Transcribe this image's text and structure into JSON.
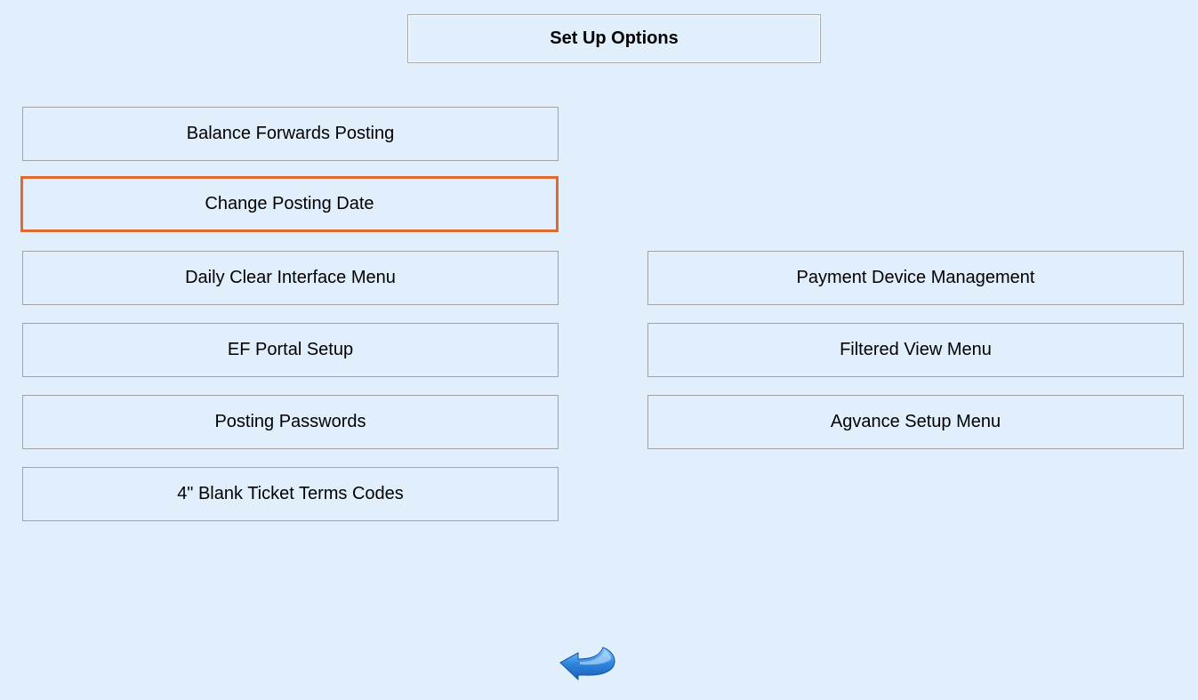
{
  "header": {
    "title": "Set Up Options"
  },
  "menu": {
    "left": [
      {
        "label": "Balance Forwards Posting"
      },
      {
        "label": "Change Posting Date"
      },
      {
        "label": "Daily Clear Interface Menu"
      },
      {
        "label": "EF Portal Setup"
      },
      {
        "label": "Posting Passwords"
      },
      {
        "label": "4\" Blank Ticket Terms Codes"
      }
    ],
    "right": [
      {
        "label": "Payment Device Management"
      },
      {
        "label": "Filtered View Menu"
      },
      {
        "label": "Agvance Setup Menu"
      }
    ]
  },
  "footer": {
    "back_icon": "back-arrow-icon"
  },
  "colors": {
    "background": "#e1eefc",
    "focus_border": "#e06a2c",
    "button_border": "#a3a3a3",
    "arrow_blue": "#2e7fd8"
  }
}
